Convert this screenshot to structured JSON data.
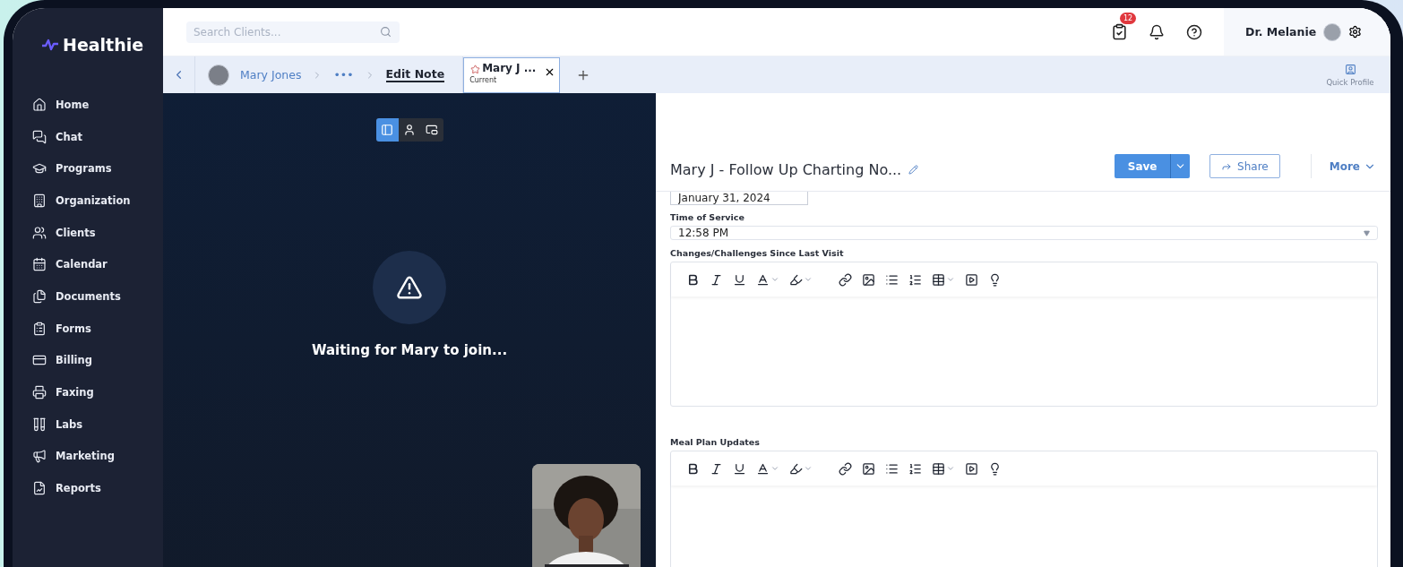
{
  "sidebar": {
    "logo": "Healthie",
    "items": [
      {
        "label": "Home",
        "kind": "home"
      },
      {
        "label": "Chat",
        "kind": "chat"
      },
      {
        "label": "Programs",
        "kind": "programs"
      },
      {
        "label": "Organization",
        "kind": "organization"
      },
      {
        "label": "Clients",
        "kind": "clients"
      },
      {
        "label": "Calendar",
        "kind": "calendar"
      },
      {
        "label": "Documents",
        "kind": "documents"
      },
      {
        "label": "Forms",
        "kind": "forms"
      },
      {
        "label": "Billing",
        "kind": "billing"
      },
      {
        "label": "Faxing",
        "kind": "faxing"
      },
      {
        "label": "Labs",
        "kind": "labs"
      },
      {
        "label": "Marketing",
        "kind": "marketing"
      },
      {
        "label": "Reports",
        "kind": "reports"
      }
    ]
  },
  "top_bar": {
    "search": {
      "placeholder": "Search Clients..."
    },
    "tasks_badge": "12",
    "user_name": "Dr. Melanie"
  },
  "tab_bar": {
    "breadcrumb": [
      {
        "label": "Mary Jones",
        "kind": "client"
      },
      {
        "label": "•••",
        "kind": "more"
      },
      {
        "label": "Edit Note",
        "kind": "current"
      }
    ],
    "tabs": [
      {
        "title": "Mary J ...",
        "subtitle": "Current",
        "selected": true
      }
    ],
    "quick_profile": "Quick Profile"
  },
  "video": {
    "layout_buttons": [
      {
        "kind": "split",
        "selected": true
      },
      {
        "kind": "speaker",
        "selected": false
      },
      {
        "kind": "pip",
        "selected": false
      }
    ],
    "message": "Waiting for Mary to join..."
  },
  "note": {
    "title": "Mary J - Follow Up Charting No...",
    "save": "Save",
    "share": "Share",
    "more": "More",
    "date_value": "January 31, 2024",
    "time_label": "Time of Service",
    "time_value": "12:58 PM",
    "editors": [
      {
        "label": "Changes/Challenges Since Last Visit"
      },
      {
        "label": "Meal Plan Updates"
      }
    ]
  }
}
